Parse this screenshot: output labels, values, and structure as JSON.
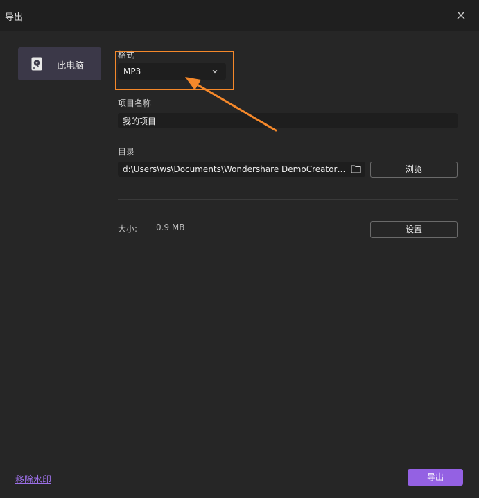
{
  "window": {
    "title": "导出"
  },
  "sidebar": {
    "items": [
      {
        "label": "此电脑",
        "icon": "hard-drive-icon"
      }
    ]
  },
  "format": {
    "label": "格式",
    "value": "MP3"
  },
  "project_name": {
    "label": "项目名称",
    "value": "我的项目"
  },
  "directory": {
    "label": "目录",
    "value": "d:\\Users\\ws\\Documents\\Wondershare DemoCreator Documents",
    "browse_label": "浏览"
  },
  "size": {
    "label": "大小:",
    "value": "0.9 MB"
  },
  "settings_label": "设置",
  "remove_watermark_label": "移除水印",
  "export_label": "导出",
  "colors": {
    "accent": "#9461e3",
    "annotation": "#f5882a",
    "background": "#262626"
  }
}
